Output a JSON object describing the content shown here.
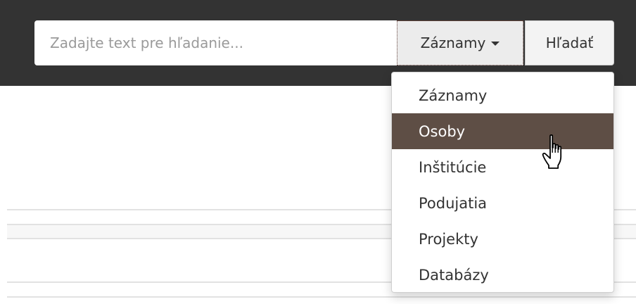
{
  "search": {
    "placeholder": "Zadajte text pre hľadanie...",
    "value": ""
  },
  "category": {
    "selected_label": "Záznamy",
    "caret_icon": "caret-down-icon"
  },
  "search_button": {
    "label": "Hľadať"
  },
  "dropdown": {
    "items": [
      {
        "label": "Záznamy"
      },
      {
        "label": "Osoby"
      },
      {
        "label": "Inštitúcie"
      },
      {
        "label": "Podujatia"
      },
      {
        "label": "Projekty"
      },
      {
        "label": "Databázy"
      }
    ],
    "highlighted": "Osoby"
  },
  "cursor": {
    "icon": "hand-pointer-icon"
  },
  "colors": {
    "navbar": "#333333",
    "highlight": "#5e4e45",
    "category_border": "#6b4a44"
  }
}
